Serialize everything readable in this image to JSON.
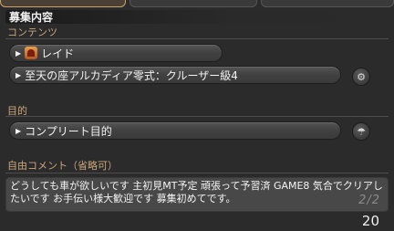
{
  "header": {
    "title": "募集内容"
  },
  "sections": {
    "contents_label": "コンテンツ",
    "purpose_label": "目的",
    "comment_label": "自由コメント（省略可）"
  },
  "content_type": {
    "label": "レイド"
  },
  "duty": {
    "label": "至天の座アルカディア零式：クルーザー級4"
  },
  "purpose": {
    "label": "コンプリート目的"
  },
  "comment": {
    "text": "どうしても車が欲しいです 主初見MT予定 頑張って予習済 GAME8 気合でクリアしたいです お手伝い様大歓迎です 募集初めてです。",
    "page_indicator": "2/2"
  },
  "char_count": "20",
  "colors": {
    "label": "#c9a67a",
    "active_tab": "#c8a26a"
  }
}
